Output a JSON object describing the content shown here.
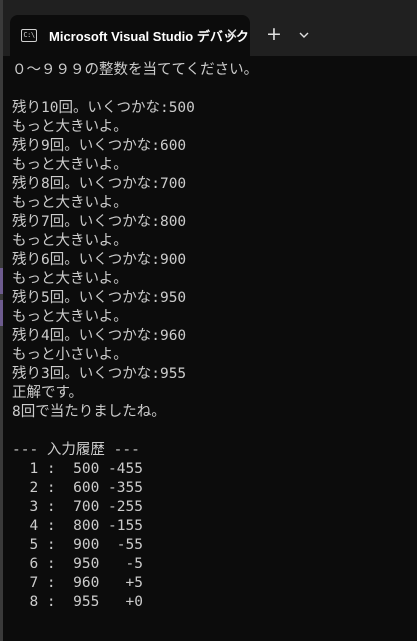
{
  "window": {
    "tab_title": "Microsoft Visual Studio デバック",
    "tab_icon_text": "C:\\",
    "close_glyph": "✕",
    "new_tab_glyph": "+"
  },
  "terminal": {
    "lines": [
      "０～９９９の整数を当ててください。",
      "",
      "残り10回。いくつかな:500",
      "もっと大きいよ。",
      "残り9回。いくつかな:600",
      "もっと大きいよ。",
      "残り8回。いくつかな:700",
      "もっと大きいよ。",
      "残り7回。いくつかな:800",
      "もっと大きいよ。",
      "残り6回。いくつかな:900",
      "もっと大きいよ。",
      "残り5回。いくつかな:950",
      "もっと大きいよ。",
      "残り4回。いくつかな:960",
      "もっと小さいよ。",
      "残り3回。いくつかな:955",
      "正解です。",
      "8回で当たりましたね。",
      "",
      "--- 入力履歴 ---",
      "  1 :  500 -455",
      "  2 :  600 -355",
      "  3 :  700 -255",
      "  4 :  800 -155",
      "  5 :  900  -55",
      "  6 :  950   -5",
      "  7 :  960   +5",
      "  8 :  955   +0"
    ]
  },
  "colors": {
    "background": "#0c0c0c",
    "titlebar": "#202020",
    "text": "#cccccc"
  }
}
